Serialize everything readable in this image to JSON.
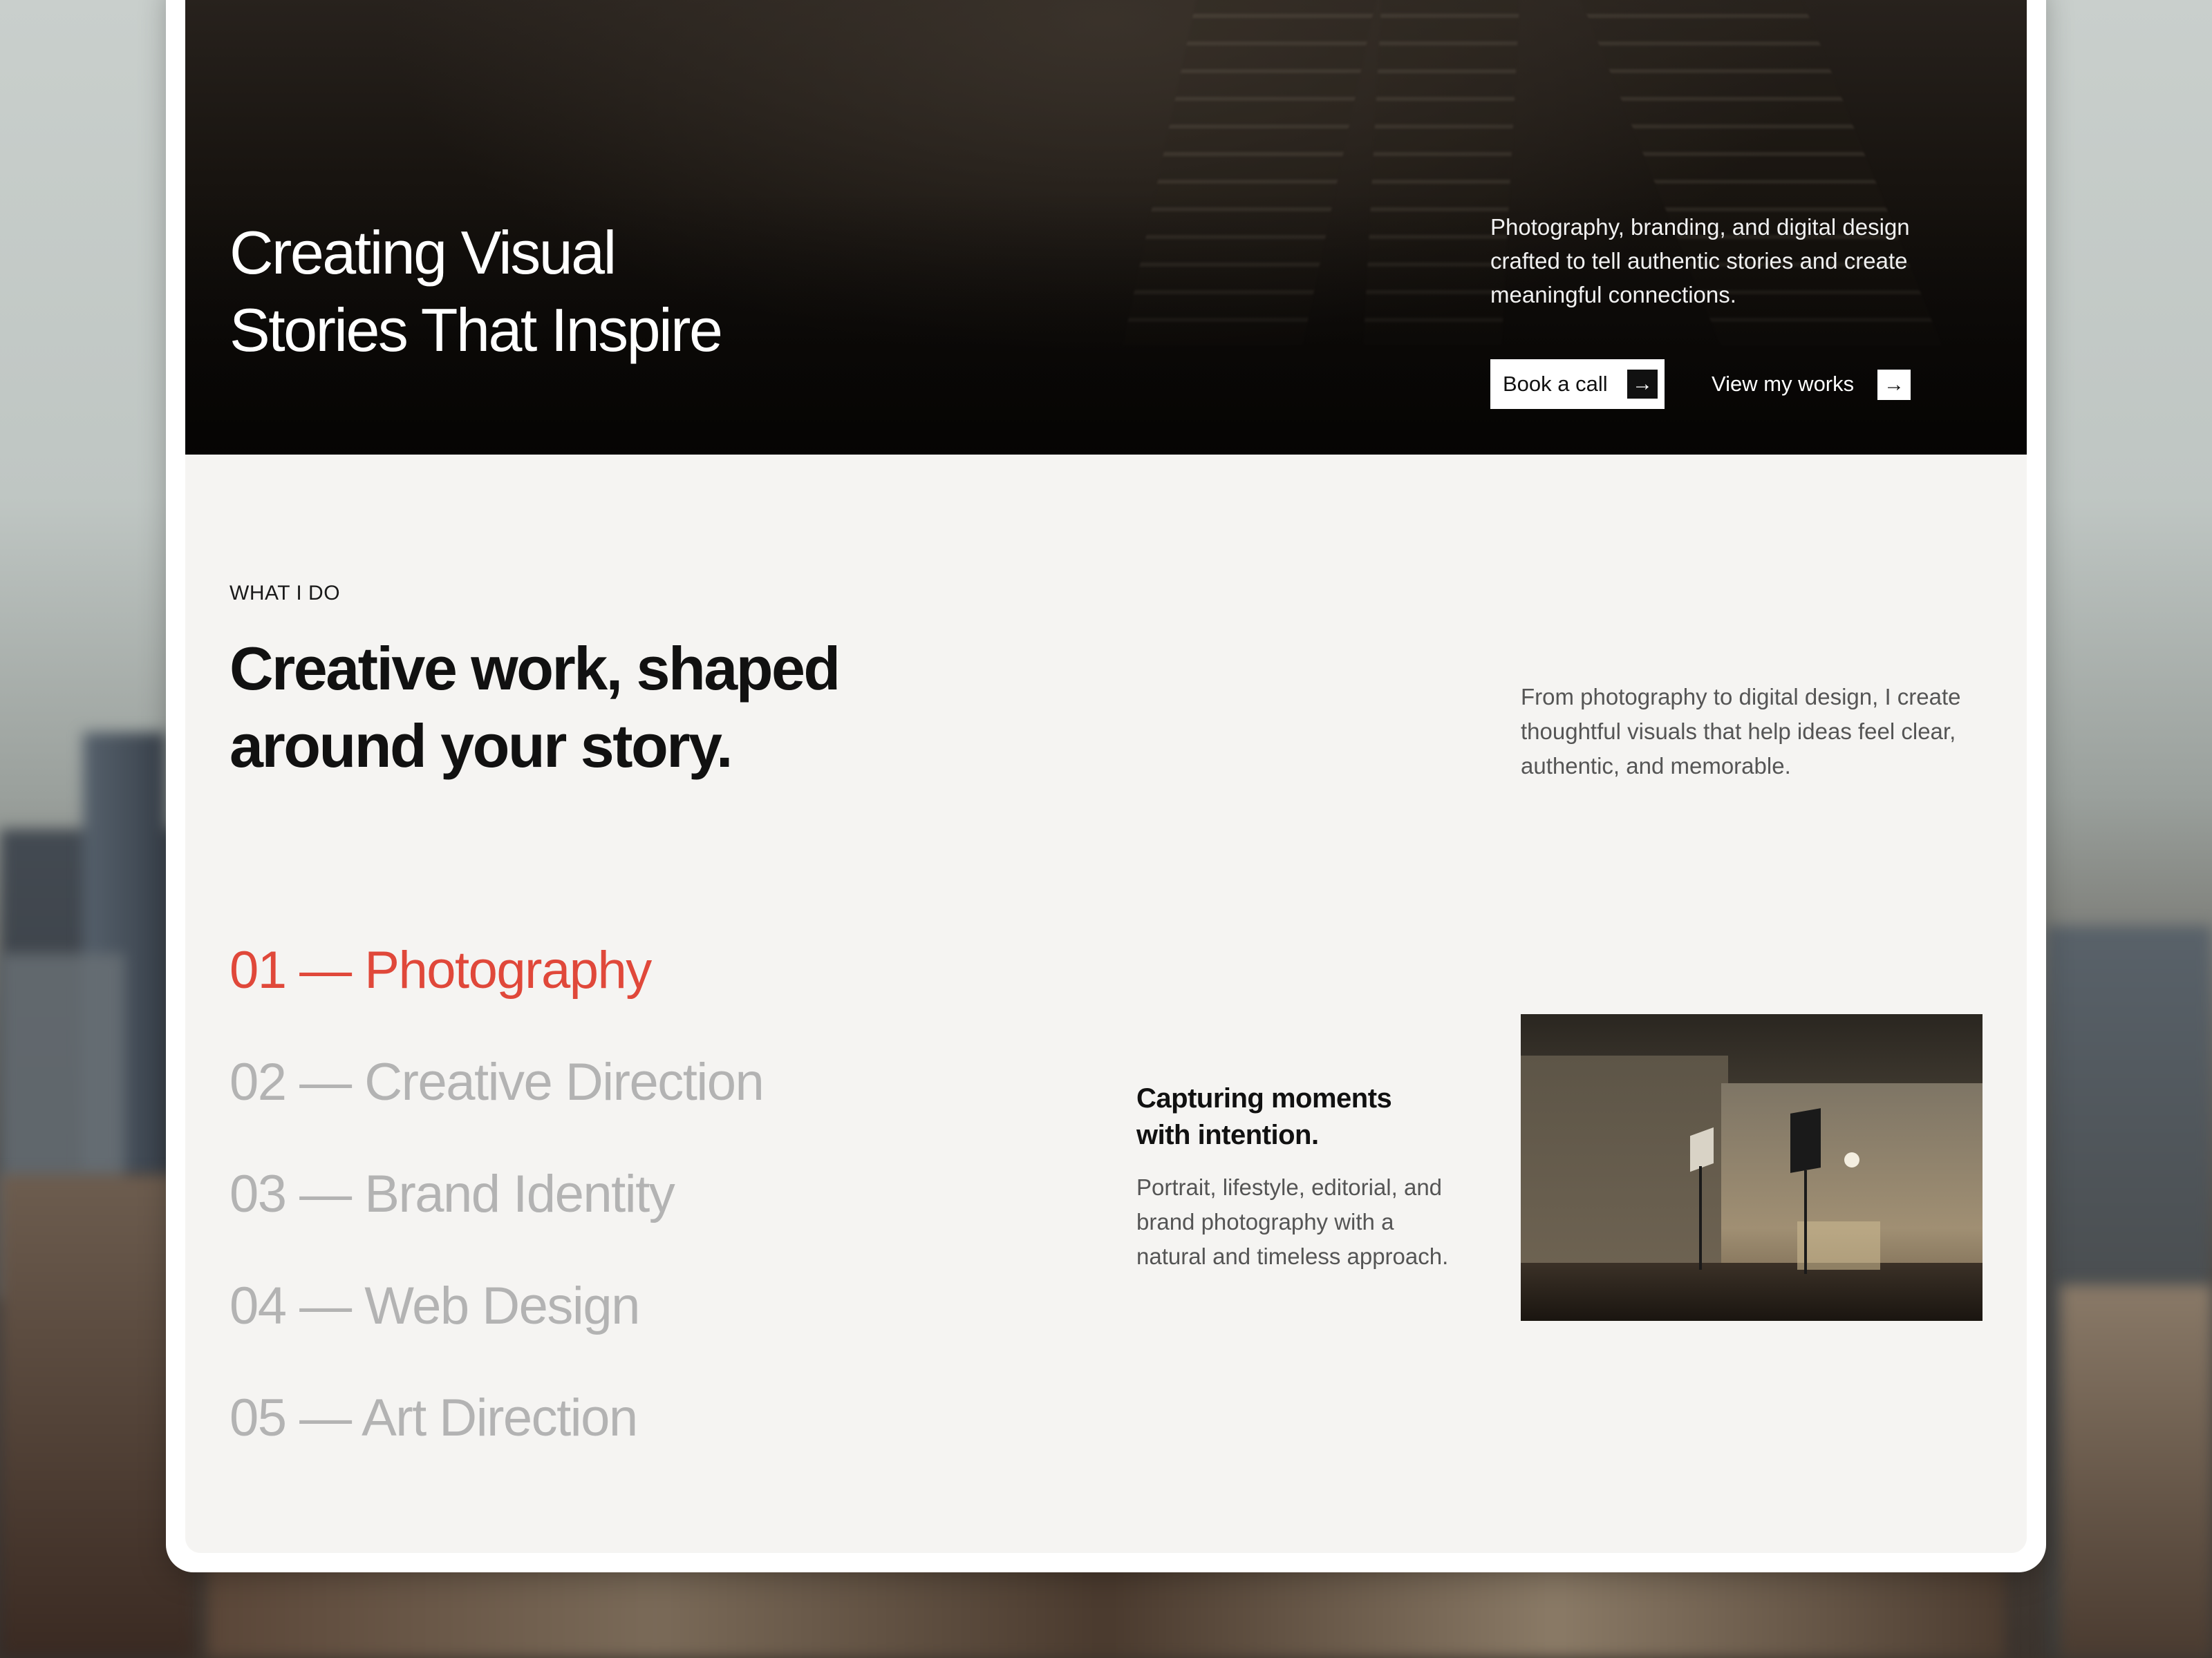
{
  "hero": {
    "title_line1": "Creating Visual",
    "title_line2": "Stories That Inspire",
    "description": "Photography, branding, and digital design crafted to tell authentic stories and create meaningful connections.",
    "book_call_label": "Book a call",
    "view_works_label": "View my works",
    "arrow_icon": "→"
  },
  "services_section": {
    "eyebrow": "WHAT I DO",
    "title_line1": "Creative work, shaped",
    "title_line2": "around your story.",
    "description": "From photography to digital design, I create thoughtful visuals that help ideas feel clear, authentic, and memorable.",
    "items": [
      {
        "label": "01 — Photography",
        "active": true
      },
      {
        "label": "02 — Creative Direction",
        "active": false
      },
      {
        "label": "03 — Brand Identity",
        "active": false
      },
      {
        "label": "04 — Web Design",
        "active": false
      },
      {
        "label": "05 — Art Direction",
        "active": false
      }
    ],
    "detail": {
      "title_line1": "Capturing moments",
      "title_line2": "with intention.",
      "description": "Portrait, lifestyle, editorial, and brand photography with a natural and timeless approach."
    }
  },
  "colors": {
    "accent": "#e0483a",
    "inactive_service": "#b3b3b3",
    "section_bg": "#f5f4f2",
    "hero_bg": "#0a0807"
  }
}
